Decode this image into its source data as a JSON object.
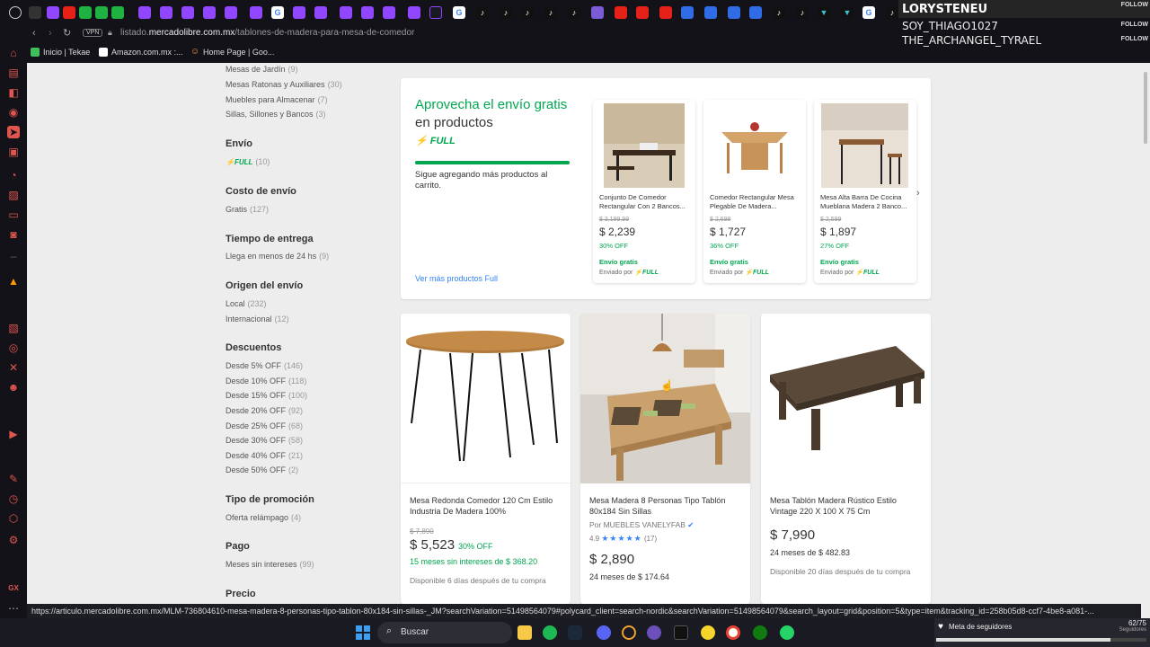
{
  "browser": {
    "url_prefix": "listado.",
    "url_domain": "mercadolibre.com.mx",
    "url_path": "/tablones-de-madera-para-mesa-de-comedor",
    "vpn_label": "VPN",
    "bookmarks": [
      "Inicio | Tekae",
      "Amazon.com.mx :...",
      "Home Page | Goo..."
    ]
  },
  "overlay": {
    "names": [
      "LORYSTENEU",
      "SOY_THIAGO1027",
      "THE_ARCHANGEL_TYRAEL"
    ],
    "follow_label": "FOLLOW"
  },
  "filters": {
    "categories": [
      {
        "label": "Mesas de Jardín",
        "count": "(9)"
      },
      {
        "label": "Mesas Ratonas y Auxiliares",
        "count": "(30)"
      },
      {
        "label": "Muebles para Almacenar",
        "count": "(7)"
      },
      {
        "label": "Sillas, Sillones y Bancos",
        "count": "(3)"
      }
    ],
    "envio": {
      "title": "Envío",
      "full_label": "FULL",
      "count": "(10)"
    },
    "costo": {
      "title": "Costo de envío",
      "option": "Gratis",
      "count": "(127)"
    },
    "tiempo": {
      "title": "Tiempo de entrega",
      "option": "Llega en menos de 24 hs",
      "count": "(9)"
    },
    "origen": {
      "title": "Origen del envío",
      "options": [
        {
          "label": "Local",
          "count": "(232)"
        },
        {
          "label": "Internacional",
          "count": "(12)"
        }
      ]
    },
    "descuentos": {
      "title": "Descuentos",
      "options": [
        {
          "label": "Desde 5% OFF",
          "count": "(146)"
        },
        {
          "label": "Desde 10% OFF",
          "count": "(118)"
        },
        {
          "label": "Desde 15% OFF",
          "count": "(100)"
        },
        {
          "label": "Desde 20% OFF",
          "count": "(92)"
        },
        {
          "label": "Desde 25% OFF",
          "count": "(68)"
        },
        {
          "label": "Desde 30% OFF",
          "count": "(58)"
        },
        {
          "label": "Desde 40% OFF",
          "count": "(21)"
        },
        {
          "label": "Desde 50% OFF",
          "count": "(2)"
        }
      ]
    },
    "promocion": {
      "title": "Tipo de promoción",
      "option": "Oferta relámpago",
      "count": "(4)"
    },
    "pago": {
      "title": "Pago",
      "option": "Meses sin intereses",
      "count": "(99)"
    },
    "precio": {
      "title": "Precio"
    }
  },
  "full_promo": {
    "title_green": "Aprovecha el envío gratis",
    "title_dark": " en productos",
    "full_label": "FULL",
    "progress": 1.0,
    "progress_text": "Sigue agregando más productos al carrito.",
    "link": "Ver más productos Full",
    "cards": [
      {
        "title": "Conjunto De Comedor Rectangular Con 2 Bancos...",
        "old": "$ 3,199.99",
        "price": "$ 2,239",
        "off": "30% OFF",
        "ship": "Envío gratis",
        "sent": "Enviado por",
        "full": "FULL"
      },
      {
        "title": "Comedor Rectangular Mesa Plegable De Madera...",
        "old": "$ 2,699",
        "price": "$ 1,727",
        "off": "36% OFF",
        "ship": "Envío gratis",
        "sent": "Enviado por",
        "full": "FULL"
      },
      {
        "title": "Mesa Alta Barra De Cocina Mueblana Madera 2 Banco...",
        "old": "$ 2,599",
        "price": "$ 1,897",
        "off": "27% OFF",
        "ship": "Envío gratis",
        "sent": "Enviado por",
        "full": "FULL"
      }
    ]
  },
  "products": [
    {
      "title": "Mesa Redonda Comedor 120 Cm Estilo Industria De Madera 100%",
      "old": "$ 7,890",
      "price": "$ 5,523",
      "off": "30% OFF",
      "installments": "15 meses sin intereses de $ 368.20",
      "availability": "Disponible 6 días después de tu compra"
    },
    {
      "title": "Mesa Madera 8 Personas Tipo Tablón 80x184 Sin Sillas",
      "seller": "Por MUEBLES VANELYFAB",
      "rating": "4.9",
      "stars": "★★★★★",
      "reviews": "(17)",
      "price": "$ 2,890",
      "installments": "24 meses de $ 174.64"
    },
    {
      "title": "Mesa Tablón Madera Rústico Estilo Vintage 220 X 100 X 75 Cm",
      "price": "$ 7,990",
      "installments": "24 meses de $ 482.83",
      "availability": "Disponible 20 días después de tu compra"
    }
  ],
  "status_url": "https://articulo.mercadolibre.com.mx/MLM-736804610-mesa-madera-8-personas-tipo-tablon-80x184-sin-sillas-_JM?searchVariation=51498564079#polycard_client=search-nordic&searchVariation=51498564079&search_layout=grid&position=5&type=item&tracking_id=258b05d8-ccf7-4be8-a081-...",
  "taskbar": {
    "search_label": "Buscar",
    "widget_title": "Meta de seguidores",
    "widget_count": "62/75",
    "widget_sub": "Seguidores",
    "widget_progress": 0.83
  },
  "colors": {
    "green": "#00a650",
    "blue": "#3483fa",
    "link": "#3483fa"
  }
}
